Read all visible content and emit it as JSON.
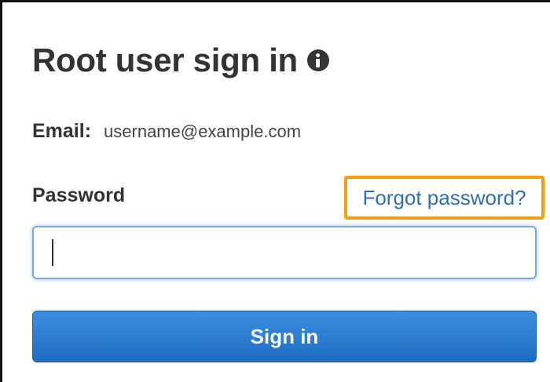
{
  "signin": {
    "title": "Root user sign in",
    "info_icon": "info-icon",
    "email_label": "Email:",
    "email_value": "username@example.com",
    "password_label": "Password",
    "forgot_password": "Forgot password?",
    "password_value": "",
    "sign_in_button": "Sign in"
  },
  "colors": {
    "title_text": "#333333",
    "link": "#2e6fbd",
    "highlight_border": "#f39c12",
    "input_focus_border": "#7eabdc",
    "button_top": "#3b8fe0",
    "button_bottom": "#1f6bc1",
    "button_text": "#ffffff"
  }
}
